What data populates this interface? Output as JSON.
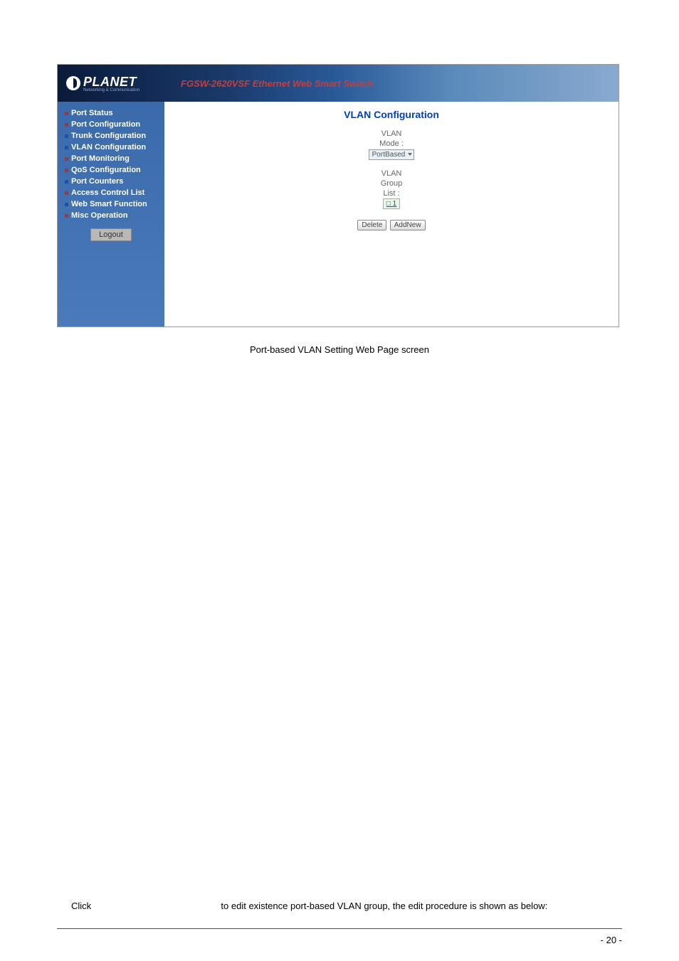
{
  "header": {
    "logo_text": "PLANET",
    "logo_subtitle": "Networking & Communication",
    "title": "FGSW-2620VSF Ethernet Web Smart Switch"
  },
  "sidebar": {
    "items": [
      {
        "label": "Port Status",
        "bullet": "red"
      },
      {
        "label": "Port Configuration",
        "bullet": "red"
      },
      {
        "label": "Trunk Configuration",
        "bullet": "blue"
      },
      {
        "label": "VLAN Configuration",
        "bullet": "blue"
      },
      {
        "label": "Port Monitoring",
        "bullet": "red"
      },
      {
        "label": "QoS Configuration",
        "bullet": "red"
      },
      {
        "label": "Port Counters",
        "bullet": "blue"
      },
      {
        "label": "Access Control List",
        "bullet": "red"
      },
      {
        "label": "Web Smart Function",
        "bullet": "blue"
      },
      {
        "label": "Misc Operation",
        "bullet": "red"
      }
    ],
    "logout_label": "Logout"
  },
  "main": {
    "title": "VLAN Configuration",
    "mode_label_line1": "VLAN",
    "mode_label_line2": "Mode :",
    "mode_value": "PortBased",
    "group_label_line1": "VLAN",
    "group_label_line2": "Group",
    "group_label_line3": "List :",
    "group_item": "□ 1",
    "delete_label": "Delete",
    "addnew_label": "AddNew"
  },
  "caption": "Port-based VLAN Setting Web Page screen",
  "bottom_text": {
    "prefix": "Click",
    "suffix": "to edit existence port-based VLAN group, the edit procedure is shown as below:"
  },
  "page_number": "- 20 -"
}
